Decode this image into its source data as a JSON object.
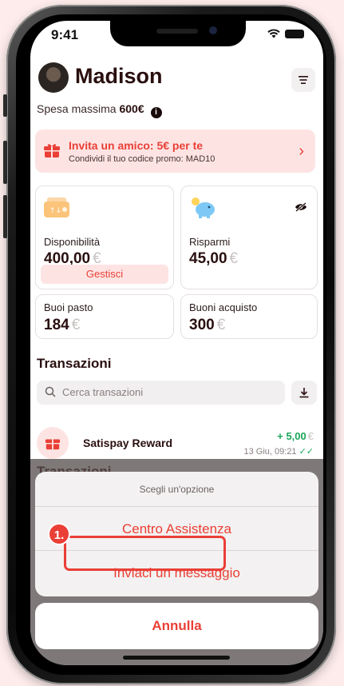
{
  "status": {
    "time": "9:41"
  },
  "header": {
    "name": "Madison"
  },
  "spend": {
    "label": "Spesa massima",
    "value": "600€"
  },
  "invite": {
    "title": "Invita un amico: 5€ per te",
    "subtitle": "Condividi il tuo codice promo: MAD10"
  },
  "cards": {
    "availability": {
      "label": "Disponibilità",
      "amount": "400,00",
      "currency": "€",
      "button": "Gestisci"
    },
    "savings": {
      "label": "Risparmi",
      "amount": "45,00",
      "currency": "€"
    },
    "meal": {
      "label": "Buoi pasto",
      "amount": "184",
      "currency": "€"
    },
    "shopping": {
      "label": "Buoni acquisto",
      "amount": "300",
      "currency": "€"
    }
  },
  "transactions": {
    "title": "Transazioni",
    "search_placeholder": "Cerca transazioni",
    "items": [
      {
        "name": "Satispay Reward",
        "amount": "+ 5,00",
        "currency": "€",
        "date": "13 Giu, 09:21"
      }
    ]
  },
  "action_sheet": {
    "title": "Scegli un'opzione",
    "options": [
      "Centro Assistenza",
      "Inviaci un messaggio"
    ],
    "cancel": "Annulla"
  },
  "annotation": {
    "step": "1."
  },
  "colors": {
    "accent": "#ea3f36",
    "positive": "#1aa65a",
    "pink_bg": "#fde4e3"
  }
}
